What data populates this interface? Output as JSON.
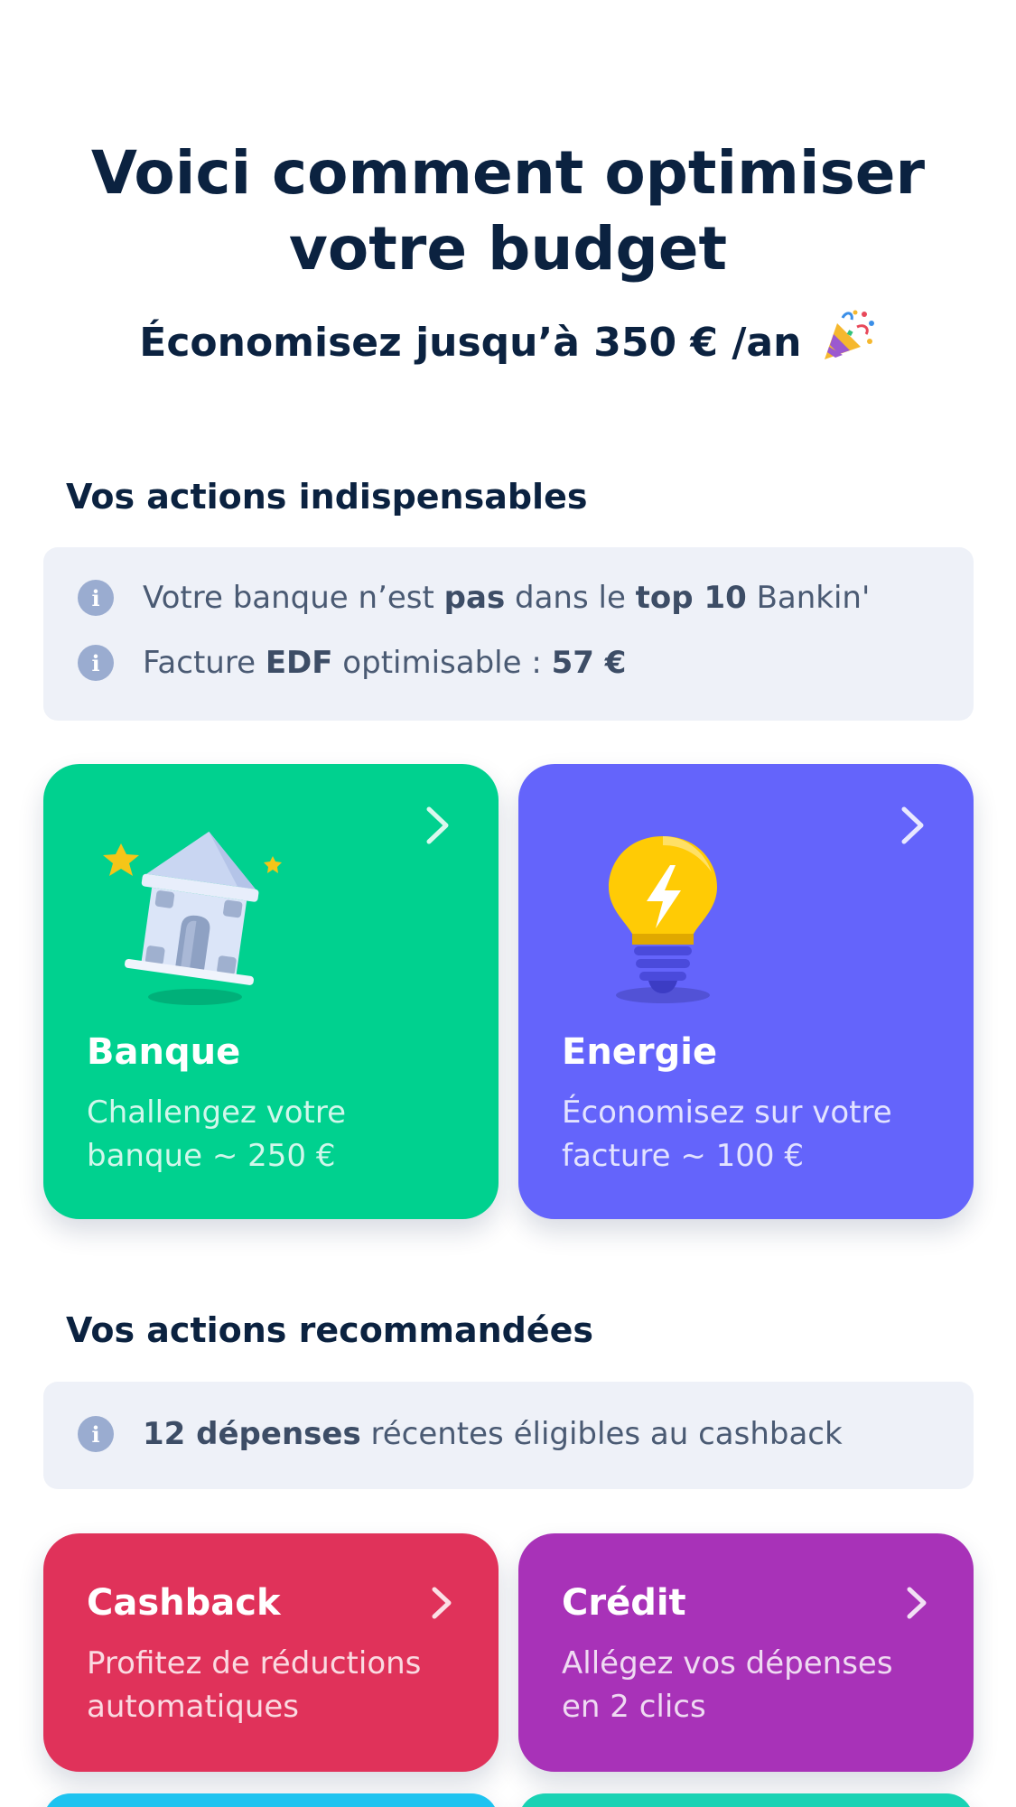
{
  "hero": {
    "title_line1": "Voici comment optimiser",
    "title_line2": "votre budget",
    "subtitle": "Économisez jusqu’à 350 € /an"
  },
  "essential": {
    "title": "Vos actions indispensables",
    "info": [
      {
        "parts": [
          {
            "text": "Votre banque n’est ",
            "bold": false
          },
          {
            "text": "pas",
            "bold": true
          },
          {
            "text": " dans le ",
            "bold": false
          },
          {
            "text": "top 10",
            "bold": true
          },
          {
            "text": " Bankin'",
            "bold": false
          }
        ]
      },
      {
        "parts": [
          {
            "text": "Facture ",
            "bold": false
          },
          {
            "text": "EDF",
            "bold": true
          },
          {
            "text": " optimisable : ",
            "bold": false
          },
          {
            "text": "57 €",
            "bold": true
          }
        ]
      }
    ],
    "cards": [
      {
        "title": "Banque",
        "desc_line1": "Challengez votre",
        "desc_line2": "banque ~ 250 €",
        "color": "#00d18f",
        "icon": "bank-icon"
      },
      {
        "title": "Energie",
        "desc_line1": "Économisez sur votre",
        "desc_line2": "facture ~ 100 €",
        "color": "#6464fb",
        "icon": "lightbulb-icon"
      }
    ]
  },
  "recommended": {
    "title": "Vos actions recommandées",
    "info": [
      {
        "parts": [
          {
            "text": "12 dépenses",
            "bold": true
          },
          {
            "text": " récentes éligibles au cashback",
            "bold": false
          }
        ]
      }
    ],
    "cards": [
      {
        "title": "Cashback",
        "desc_line1": "Profitez de réductions",
        "desc_line2": "automatiques",
        "color": "#e0325a"
      },
      {
        "title": "Crédit",
        "desc_line1": "Allégez vos dépenses",
        "desc_line2": "en 2 clics",
        "color": "#a832b8"
      }
    ],
    "partial_card_colors": [
      "#1ec3f0",
      "#19d2b4"
    ]
  },
  "icons": {
    "info": "info-icon",
    "chevron": "chevron-right-icon",
    "party": "party-popper-icon"
  }
}
